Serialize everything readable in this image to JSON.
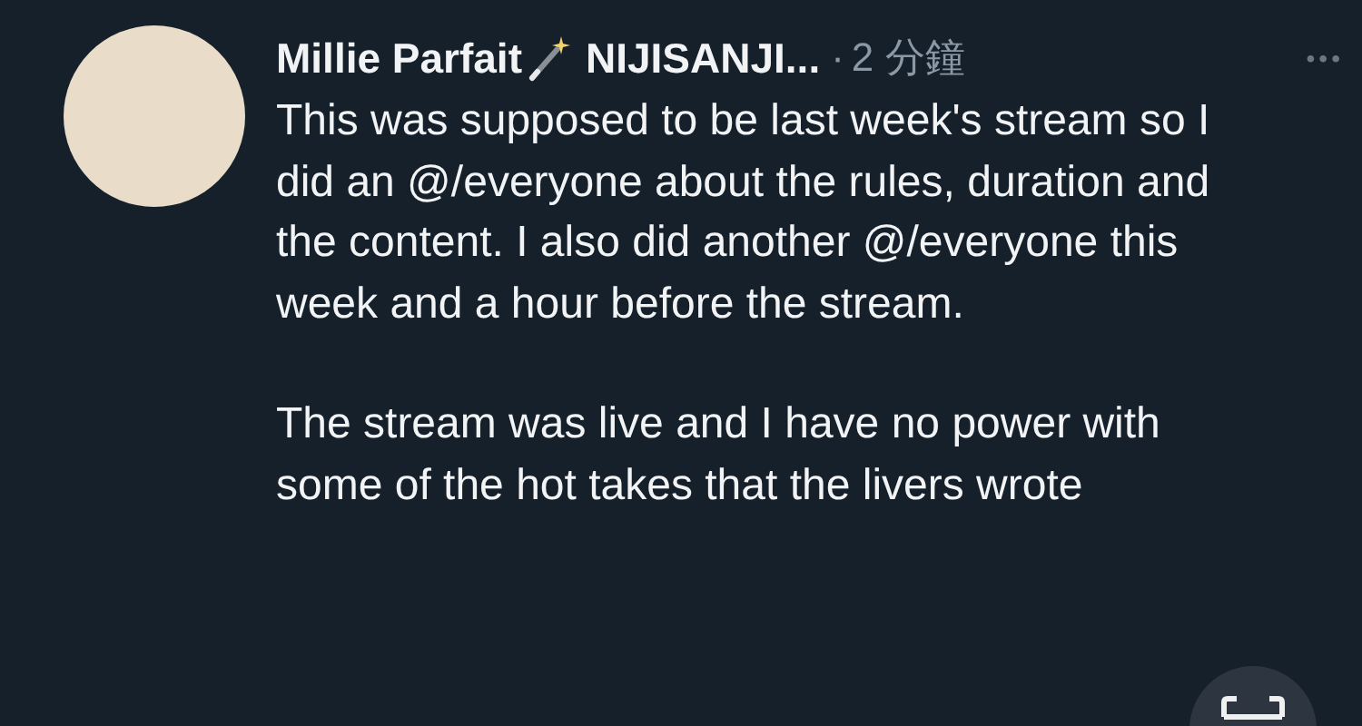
{
  "tweet": {
    "author_name": "Millie Parfait",
    "author_handle": "NIJISANJI...",
    "separator": "·",
    "time": "2 分鐘",
    "more": "•••",
    "paragraphs": [
      "This was supposed to be last week's stream so I did an @/everyone about the rules, duration and the content. I also did another @/everyone this week and a hour before the stream.",
      "The stream was live and I have no power with some of the hot takes that the livers wrote"
    ]
  }
}
